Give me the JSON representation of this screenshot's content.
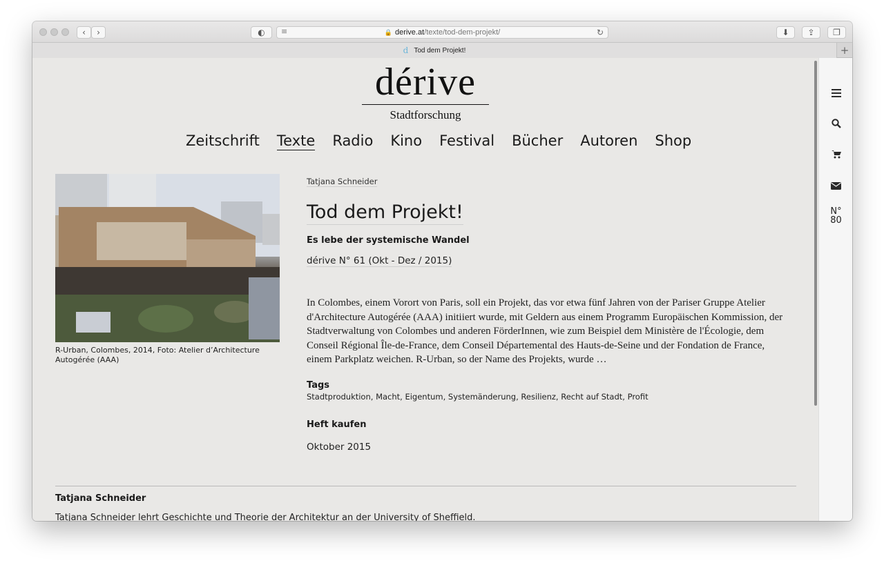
{
  "browser": {
    "url_domain": "derive.at",
    "url_path": "/texte/tod-dem-projekt/",
    "tab_title": "Tod dem Projekt!",
    "tab_favicon": "d"
  },
  "site": {
    "logo": "dérive",
    "logo_subtitle": "Stadtforschung",
    "nav": [
      "Zeitschrift",
      "Texte",
      "Radio",
      "Kino",
      "Festival",
      "Bücher",
      "Autoren",
      "Shop"
    ],
    "active_nav": "Texte",
    "issue_number": [
      "N°",
      "80"
    ],
    "sidebar_icons": [
      "menu-icon",
      "search-icon",
      "cart-icon",
      "mail-icon"
    ]
  },
  "article": {
    "image_caption": "R-Urban, Colombes, 2014, Foto: Atelier d’Architecture Autogérée (AAA)",
    "author": "Tatjana Schneider",
    "title": "Tod dem Projekt!",
    "subtitle": "Es lebe der systemische Wandel",
    "issue": "dérive N° 61 (Okt - Dez / 2015)",
    "teaser": "In Colombes, einem Vorort von Paris, soll ein Projekt, das vor etwa fünf Jahren von der Pariser Gruppe Atelier d'Architecture Autogérée (AAA) initiiert wurde, mit Geldern aus einem Programm Europäischen Kommission, der Stadtverwaltung von Colombes und anderen FörderInnen, wie zum Beispiel dem Ministère de l'Écologie, dem Conseil Régional Île-de-France, dem Conseil Départemental des Hauts-de-Seine und der Fondation de France, einem Parkplatz weichen. R-Urban, so der Name des Projekts, wurde …",
    "tags_heading": "Tags",
    "tags": "Stadtproduktion, Macht, Eigentum, Systemänderung, Resilienz, Recht auf Stadt, Profit",
    "buy_heading": "Heft kaufen",
    "date": "Oktober 2015"
  },
  "bio": {
    "name": "Tatjana Schneider",
    "text": "Tatjana Schneider lehrt Geschichte und Theorie der Architektur an der University of Sheffield."
  }
}
